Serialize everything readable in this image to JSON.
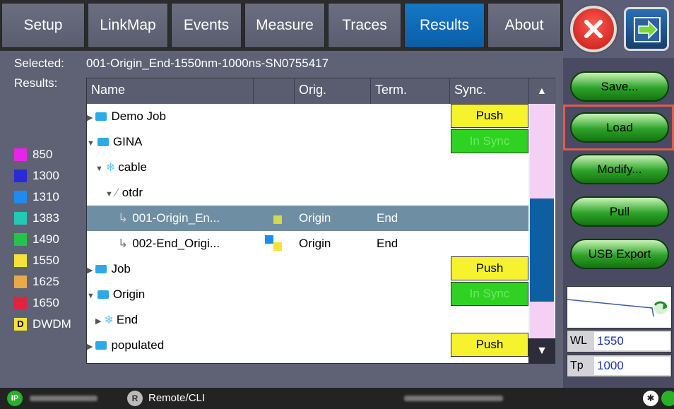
{
  "tabs": [
    {
      "label": "Setup",
      "active": false
    },
    {
      "label": "LinkMap",
      "active": false
    },
    {
      "label": "Events",
      "active": false
    },
    {
      "label": "Measure",
      "active": false
    },
    {
      "label": "Traces",
      "active": false
    },
    {
      "label": "Results",
      "active": true
    },
    {
      "label": "About",
      "active": false
    }
  ],
  "info": {
    "selected_label": "Selected:",
    "selected_value": "001-Origin_End-1550nm-1000ns-SN0755417",
    "results_label": "Results:"
  },
  "legend": [
    {
      "label": "850",
      "color": "#e626e6"
    },
    {
      "label": "1300",
      "color": "#2a2ad8"
    },
    {
      "label": "1310",
      "color": "#1d8cf0"
    },
    {
      "label": "1383",
      "color": "#22c9b4"
    },
    {
      "label": "1490",
      "color": "#27c24c"
    },
    {
      "label": "1550",
      "color": "#f6e23a"
    },
    {
      "label": "1625",
      "color": "#e7a94a"
    },
    {
      "label": "1650",
      "color": "#e0233e"
    },
    {
      "label": "DWDM",
      "badge": "D"
    }
  ],
  "table": {
    "headers": {
      "name": "Name",
      "blank": "",
      "orig": "Orig.",
      "term": "Term.",
      "sync": "Sync."
    },
    "rows": [
      {
        "name": "Demo Job",
        "orig": "",
        "term": "",
        "sync": "Push"
      },
      {
        "name": "GINA",
        "orig": "",
        "term": "",
        "sync": "In Sync"
      },
      {
        "name": "cable",
        "orig": "",
        "term": "",
        "sync": ""
      },
      {
        "name": "otdr",
        "orig": "",
        "term": "",
        "sync": ""
      },
      {
        "name": "001-Origin_En...",
        "orig": "Origin",
        "term": "End",
        "sync": ""
      },
      {
        "name": "002-End_Origi...",
        "orig": "Origin",
        "term": "End",
        "sync": ""
      },
      {
        "name": "Job",
        "orig": "",
        "term": "",
        "sync": "Push"
      },
      {
        "name": "Origin",
        "orig": "",
        "term": "",
        "sync": "In Sync"
      },
      {
        "name": "End",
        "orig": "",
        "term": "",
        "sync": ""
      },
      {
        "name": "populated",
        "orig": "",
        "term": "",
        "sync": "Push"
      }
    ]
  },
  "actions": {
    "save": "Save...",
    "load": "Load",
    "modify": "Modify...",
    "pull": "Pull",
    "usb_export": "USB Export"
  },
  "params": {
    "wl_label": "WL",
    "wl_value": "1550",
    "tp_label": "Tp",
    "tp_value": "1000"
  },
  "status": {
    "ip_badge": "IP",
    "r_badge": "R",
    "remote": "Remote/CLI"
  }
}
